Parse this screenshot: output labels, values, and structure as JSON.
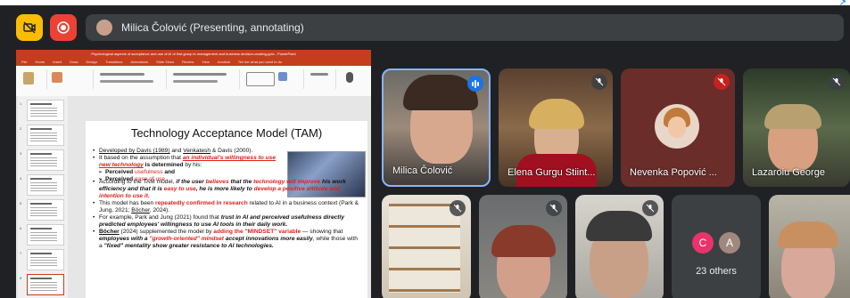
{
  "meeting": {
    "presenter_label": "Milica Čolović (Presenting, annotating)"
  },
  "presentation": {
    "window_title": "Psychological aspects of acceptance and use of AI of first group in management and business decision-making.pptx - PowerPoint",
    "menu": [
      "File",
      "Home",
      "Insert",
      "Draw",
      "Design",
      "Transitions",
      "Animations",
      "Slide Show",
      "Review",
      "View",
      "Acrobat",
      "Tell me what you want to do"
    ],
    "slide_numbers": [
      "1",
      "2",
      "3",
      "4",
      "5",
      "6",
      "7",
      "8"
    ],
    "slide": {
      "title": "Technology Acceptance Model (TAM)",
      "b1_a": "Developed by ",
      "b1_b": "Davis (1989)",
      "b1_c": " and ",
      "b1_d": "Venkatesh",
      "b1_e": " & Davis (2000).",
      "b2_a": "It based on the assumption that ",
      "b2_b": "an individual's willingness to use new technology",
      "b2_c": " is determined",
      "b2_d": " by his:",
      "s1_a": "Perceived ",
      "s1_b": "usefulness",
      "s1_c": " and",
      "s2_a": "Perceived ",
      "s2_b": "ease of use.",
      "b3_a": "According to the TAM model, ",
      "b3_b": "if the user ",
      "b3_c": "believes",
      "b3_d": " that the ",
      "b3_e": "technology will improve",
      "b3_f": " his work efficiency and that it is ",
      "b3_g": "easy to use",
      "b3_h": ", he is more likely to ",
      "b3_i": "develop a positive attitude and intention to use it.",
      "b4_a": "This model has been ",
      "b4_b": "repeatedly confirmed in research",
      "b4_c": " related to AI in a business context (Park & Jung, 2021; ",
      "b4_d": "Böcher",
      "b4_e": ", 2024).",
      "b5_a": "For example, Park and Jung (2021) found that ",
      "b5_b": "trust in AI and perceived usefulness directly predicted employees' willingness to use AI tools in their daily work.",
      "b6_a": "Böcher",
      "b6_b": " (2024) supplemented the model by ",
      "b6_c": "adding the \"MINDSET\" variable",
      "b6_d": " — showing that ",
      "b6_e": "employees with a ",
      "b6_f": "\"growth-oriented\" mindset",
      "b6_g": " accept innovations more easily",
      "b6_h": ", while those with a ",
      "b6_i": "\"fixed\" mentality",
      "b6_j": " show greater resistance to AI technologies."
    }
  },
  "participants": [
    {
      "name": "Milica Čolović",
      "state": "speaking"
    },
    {
      "name": "Elena Gurgu Stiint...",
      "state": "muted"
    },
    {
      "name": "Nevenka Popović ...",
      "state": "muted-red"
    },
    {
      "name": "Lazaroiu George",
      "state": "muted"
    },
    {
      "name": "",
      "state": "muted"
    },
    {
      "name": "",
      "state": "muted"
    },
    {
      "name": "",
      "state": "muted"
    }
  ],
  "others": {
    "label": "23 others",
    "avatars": [
      {
        "letter": "C",
        "color": "#e8336b"
      },
      {
        "letter": "A",
        "color": "#a1887f"
      }
    ]
  },
  "colors": {
    "accent_yellow": "#fbbc04",
    "accent_red": "#ea4335",
    "ppt_brand": "#c43e1c",
    "speaking_blue": "#1a73e8"
  }
}
